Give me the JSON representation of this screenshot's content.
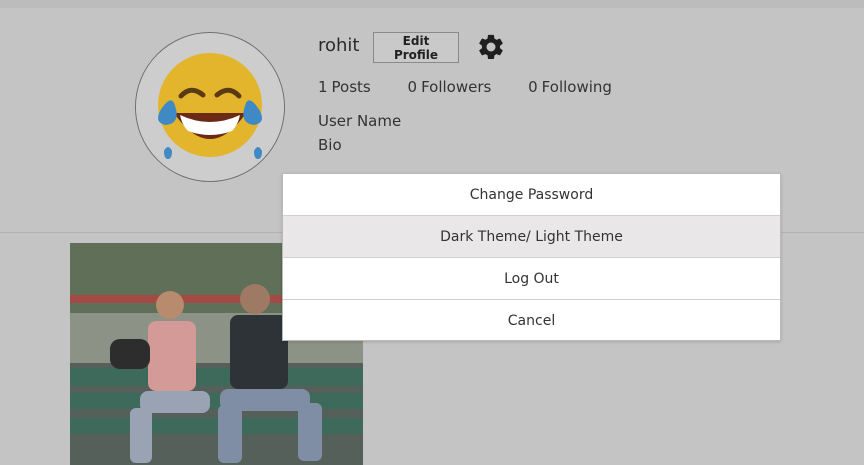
{
  "profile": {
    "username": "rohit",
    "edit_label": "Edit Profile",
    "stats": {
      "posts_count": "1",
      "posts_label": "Posts",
      "followers_count": "0",
      "followers_label": "Followers",
      "following_count": "0",
      "following_label": "Following"
    },
    "full_name": "User Name",
    "bio": "Bio"
  },
  "menu": {
    "items": [
      {
        "label": "Change Password"
      },
      {
        "label": "Dark Theme/ Light Theme"
      },
      {
        "label": "Log Out"
      },
      {
        "label": "Cancel"
      }
    ]
  },
  "icons": {
    "settings": "gear-icon",
    "avatar": "laughing-emoji"
  },
  "colors": {
    "overlay": "#c4c4c4",
    "modal_bg": "#ffffff",
    "active_item": "#e9e7e7"
  }
}
